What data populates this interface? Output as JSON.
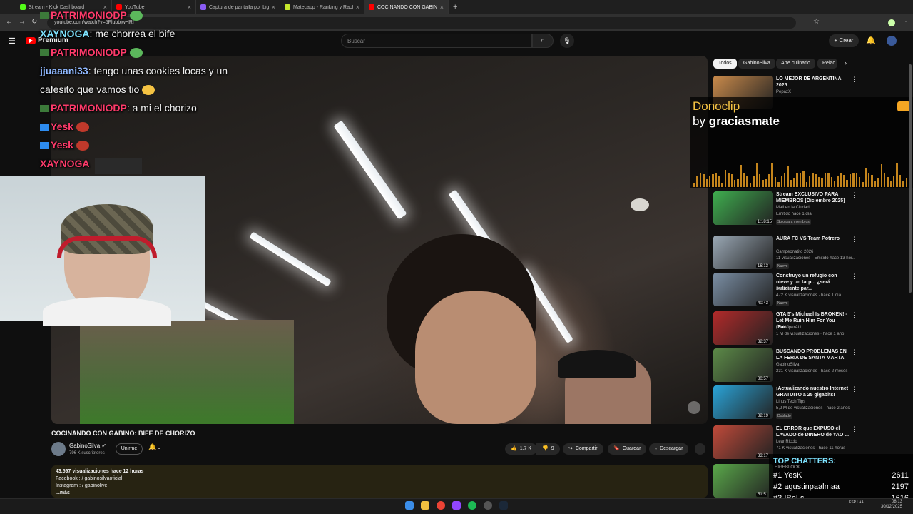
{
  "browser": {
    "tabs": [
      {
        "label": "Stream - Kick Dashboard",
        "color": "#53fc18"
      },
      {
        "label": "YouTube",
        "color": "#ff0000"
      },
      {
        "label": "Captura de pantalla por Lightshot",
        "color": "#8a5cf6"
      },
      {
        "label": "Matecapp - Ranking y Racha d",
        "color": "#c6e82c"
      },
      {
        "label": "COCINANDO CON GABINO: BIF",
        "color": "#ff0000"
      }
    ],
    "url": "youtube.com/watch?v=5FlubbjwHRI"
  },
  "header": {
    "logo_text": "Premium",
    "search_placeholder": "Buscar",
    "create_label": "+ Crear"
  },
  "chat": [
    {
      "user": "PATRIMONIODP",
      "msg": "",
      "color": "#ff3b6b"
    },
    {
      "user": "XAYNOGA",
      "msg": ": me chorrea el bife",
      "color": "#7ee3ff"
    },
    {
      "user": "PATRIMONIODP",
      "msg": "",
      "color": "#ff3b6b"
    },
    {
      "user": "jjuaaani33",
      "msg": ": tengo unas cookies locas y un",
      "color": "#8fb8ff"
    },
    {
      "user": "",
      "msg": "cafesito que vamos tio",
      "color": "#ffffff"
    },
    {
      "user": "PATRIMONIODP",
      "msg": ": a mi el chorizo",
      "color": "#ff3b6b"
    },
    {
      "user": "Yesk",
      "msg": "",
      "color": "#ff3b6b"
    },
    {
      "user": "Yesk",
      "msg": "",
      "color": "#ff3b6b"
    },
    {
      "user": "XAYNOGA",
      "msg": "",
      "color": "#ff3b6b"
    }
  ],
  "donoclip": {
    "title": "Donoclip",
    "by": "by",
    "user": "graciasmate"
  },
  "video": {
    "title": "COCINANDO CON GABINO: BIFE DE CHORIZO",
    "channel": "GabinoSilva",
    "subscribers": "796 K suscriptores",
    "join_label": "Unirme",
    "likes": "1,7 K",
    "dislikes": "9",
    "share_label": "Compartir",
    "save_label": "Guardar",
    "download_label": "Descargar"
  },
  "description": {
    "stats": "43.597 visualizaciones  hace 12 horas",
    "line1": "Facebook :  / gabinosilvaoficial",
    "line2": "Instagram :  / gabinolive",
    "more": "...más"
  },
  "chips": [
    "Todos",
    "GabinoSilva",
    "Arte culinario",
    "Relac"
  ],
  "recommendations": [
    {
      "title": "LO MEJOR DE ARGENTINA 2025",
      "channel": "PepazX",
      "meta": "",
      "duration": "",
      "badge": "",
      "color": "#c98a4b"
    },
    {
      "title": "Stream EXCLUSIVO PARA MIEMBROS [Diciembre 2025]",
      "channel": "Mati en la Ciudad",
      "meta": "Emitido hace 1 día",
      "duration": "1:18:15",
      "badge": "Solo para miembros",
      "color": "#3fae4f"
    },
    {
      "title": "AURA FC VS Team Potrero",
      "channel": "Campeonatito 2026",
      "meta": "11 visualizaciones · Emitido hace 13 hor...",
      "duration": "16:13",
      "badge": "Nuevo",
      "color": "#9aa8b5"
    },
    {
      "title": "Construyo un refugio con nieve y un tarp... ¿será suficiente par...",
      "channel": "Delvidcat",
      "meta": "472 K visualizaciones · hace 1 día",
      "duration": "40:43",
      "badge": "Nuevo",
      "color": "#7b8fa5"
    },
    {
      "title": "GTA 5's Michael Is BROKEN! - Let Me Ruin Him For You (Fact...",
      "channel": "DarkViperAU",
      "meta": "1 M de visualizaciones · hace 1 año",
      "duration": "32:37",
      "badge": "",
      "color": "#b22a2a"
    },
    {
      "title": "BUSCANDO PROBLEMAS EN LA FERIA DE SANTA MARTA",
      "channel": "GabinoSilva",
      "meta": "231 K visualizaciones · hace 2 meses",
      "duration": "30:57",
      "badge": "",
      "color": "#5c8a48"
    },
    {
      "title": "¡Actualizando nuestro Internet GRATUITO a 25 gigabits!",
      "channel": "Linus Tech Tips",
      "meta": "5,2 M de visualizaciones · hace 2 años",
      "duration": "32:19",
      "badge": "Doblado",
      "color": "#2aa4d8"
    },
    {
      "title": "EL ERROR que EXPUSO el LAVADO de DINERO de YAO ...",
      "channel": "LeanRiccio",
      "meta": "71 K visualizaciones · hace 11 horas",
      "duration": "33:17",
      "badge": "",
      "color": "#c04a3a"
    },
    {
      "title": "",
      "channel": "",
      "meta": "",
      "duration": "51:5",
      "badge": "",
      "color": "#5aa84a"
    }
  ],
  "top_chatters": {
    "title": "TOP CHATTERS:",
    "subtitle": "HIGHBLOCK",
    "rows": [
      {
        "rank": "#1",
        "name": "YesK",
        "count": "2611"
      },
      {
        "rank": "#2",
        "name": "agustinpaalmaa",
        "count": "2197"
      },
      {
        "rank": "#3",
        "name": "IBeLs",
        "count": "1616"
      }
    ]
  },
  "taskbar": {
    "lang": "ESP LAA",
    "time": "08:13",
    "date": "30/12/2025"
  }
}
